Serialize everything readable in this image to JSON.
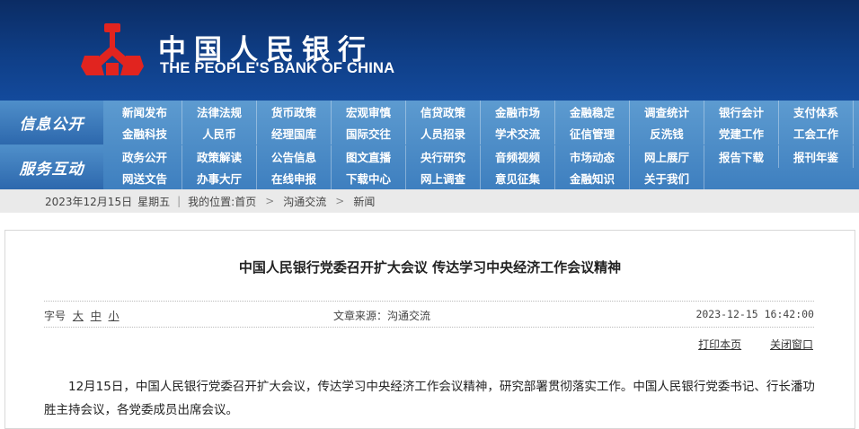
{
  "header": {
    "brand_cn": "中国人民银行",
    "brand_en": "THE PEOPLE'S BANK OF CHINA",
    "logo_icon": "pboc-emblem-icon",
    "colors": {
      "banner": "#0f3e86",
      "emblem": "#e1241f",
      "nav": "#4a88c5"
    }
  },
  "nav": {
    "info_label": "信息公开",
    "info_items": [
      "新闻发布",
      "法律法规",
      "货币政策",
      "宏观审慎",
      "信贷政策",
      "金融市场",
      "金融稳定",
      "调查统计",
      "银行会计",
      "支付体系",
      "金融科技",
      "人民币",
      "经理国库",
      "国际交往",
      "人员招录",
      "学术交流",
      "征信管理",
      "反洗钱",
      "党建工作",
      "工会工作"
    ],
    "service_label": "服务互动",
    "service_items": [
      "政务公开",
      "政策解读",
      "公告信息",
      "图文直播",
      "央行研究",
      "音频视频",
      "市场动态",
      "网上展厅",
      "报告下载",
      "报刊年鉴",
      "网送文告",
      "办事大厅",
      "在线申报",
      "下载中心",
      "网上调查",
      "意见征集",
      "金融知识",
      "关于我们"
    ]
  },
  "breadcrumb": {
    "date": "2023年12月15日",
    "weekday": "星期五",
    "prefix": "我的位置:",
    "home": "首页",
    "sep": ">",
    "level1": "沟通交流",
    "level2": "新闻"
  },
  "article": {
    "title": "中国人民银行党委召开扩大会议 传达学习中央经济工作会议精神",
    "font_label": "字号",
    "font_large": "大",
    "font_medium": "中",
    "font_small": "小",
    "source": "文章来源：沟通交流",
    "datetime": "2023-12-15 16:42:00",
    "print_label": "打印本页",
    "close_label": "关闭窗口",
    "body": "12月15日，中国人民银行党委召开扩大会议，传达学习中央经济工作会议精神，研究部署贯彻落实工作。中国人民银行党委书记、行长潘功胜主持会议，各党委成员出席会议。"
  }
}
